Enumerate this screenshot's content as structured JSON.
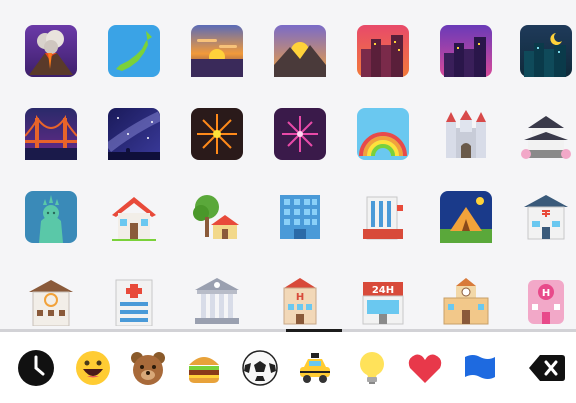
{
  "emoji_grid": {
    "rows": [
      [
        "volcano-icon",
        "japan-map-icon",
        "sunrise-icon",
        "sunrise-over-mountains-icon",
        "cityscape-at-dusk-icon",
        "sunset-icon",
        "night-with-stars-icon"
      ],
      [
        "bridge-at-night-icon",
        "milky-way-icon",
        "fireworks-icon",
        "sparkler-icon",
        "rainbow-icon",
        "european-castle-icon",
        "japanese-castle-icon"
      ],
      [
        "statue-of-liberty-icon",
        "house-icon",
        "house-with-garden-icon",
        "office-building-icon",
        "department-store-icon",
        "camping-icon",
        "post-office-icon"
      ],
      [
        "love-hotel-icon",
        "hospital-icon",
        "bank-icon",
        "hotel-icon",
        "convenience-store-icon",
        "school-icon",
        "love-hotel-pink-icon"
      ]
    ],
    "convenience_store_sign": "24H",
    "hotel_letter": "H"
  },
  "scroll": {
    "position": 0.55
  },
  "categories": [
    {
      "name": "recent-clock-icon",
      "selected": true
    },
    {
      "name": "smileys-icon",
      "selected": false
    },
    {
      "name": "animals-bear-icon",
      "selected": false
    },
    {
      "name": "food-burger-icon",
      "selected": false
    },
    {
      "name": "activity-soccer-icon",
      "selected": false
    },
    {
      "name": "travel-taxi-icon",
      "selected": false
    },
    {
      "name": "objects-lightbulb-icon",
      "selected": false
    },
    {
      "name": "symbols-heart-icon",
      "selected": false
    },
    {
      "name": "flags-icon",
      "selected": false
    },
    {
      "name": "backspace-icon",
      "selected": false
    }
  ]
}
